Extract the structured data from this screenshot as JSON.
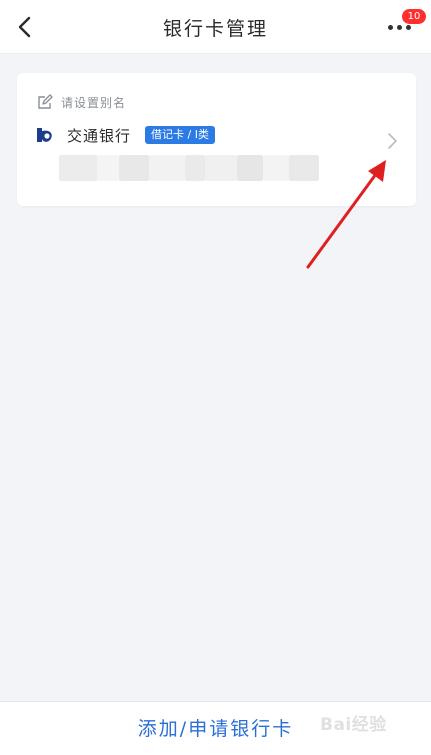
{
  "header": {
    "title": "银行卡管理",
    "back_icon": "chevron-left-icon",
    "more_icon": "more-horizontal-icon",
    "badge_count": "10",
    "badge_color": "#ff2f2f"
  },
  "card": {
    "alias_placeholder": "请设置别名",
    "alias_icon": "edit-icon",
    "bank_name": "交通银行",
    "bank_logo_icon": "bocom-logo-icon",
    "card_type": "借记卡 / I类",
    "card_type_color": "#2c7be5",
    "card_number": "(blurred)",
    "chevron_icon": "chevron-right-icon"
  },
  "bottom_bar": {
    "add_button_label": "添加/申请银行卡",
    "accent_color": "#2a6fd8"
  },
  "annotation": {
    "arrow_color": "#e02020",
    "arrow_icon": "red-arrow-icon"
  },
  "watermark": {
    "text": "Bai经验"
  }
}
